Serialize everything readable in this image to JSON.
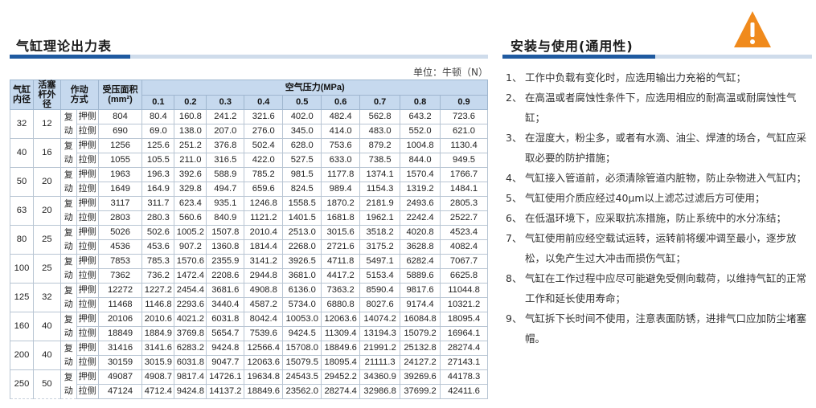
{
  "left": {
    "title": "气缸理论出力表",
    "unit": "单位：牛顿（N）",
    "headers": {
      "bore": "气缸\n内径",
      "rod": "活塞\n杆外径",
      "mode": "作动\n方式",
      "area": "受压面积\n(mm²)",
      "pressure_title": "空气压力(MPa)",
      "pressures": [
        "0.1",
        "0.2",
        "0.3",
        "0.4",
        "0.5",
        "0.6",
        "0.7",
        "0.8",
        "0.9"
      ]
    },
    "mode_label": "复\n动",
    "push_label": "押侧",
    "pull_label": "拉侧",
    "rows": [
      {
        "bore": "32",
        "rod": "12",
        "push": {
          "area": "804",
          "vals": [
            "80.4",
            "160.8",
            "241.2",
            "321.6",
            "402.0",
            "482.4",
            "562.8",
            "643.2",
            "723.6"
          ]
        },
        "pull": {
          "area": "690",
          "vals": [
            "69.0",
            "138.0",
            "207.0",
            "276.0",
            "345.0",
            "414.0",
            "483.0",
            "552.0",
            "621.0"
          ]
        }
      },
      {
        "bore": "40",
        "rod": "16",
        "push": {
          "area": "1256",
          "vals": [
            "125.6",
            "251.2",
            "376.8",
            "502.4",
            "628.0",
            "753.6",
            "879.2",
            "1004.8",
            "1130.4"
          ]
        },
        "pull": {
          "area": "1055",
          "vals": [
            "105.5",
            "211.0",
            "316.5",
            "422.0",
            "527.5",
            "633.0",
            "738.5",
            "844.0",
            "949.5"
          ]
        }
      },
      {
        "bore": "50",
        "rod": "20",
        "push": {
          "area": "1963",
          "vals": [
            "196.3",
            "392.6",
            "588.9",
            "785.2",
            "981.5",
            "1177.8",
            "1374.1",
            "1570.4",
            "1766.7"
          ]
        },
        "pull": {
          "area": "1649",
          "vals": [
            "164.9",
            "329.8",
            "494.7",
            "659.6",
            "824.5",
            "989.4",
            "1154.3",
            "1319.2",
            "1484.1"
          ]
        }
      },
      {
        "bore": "63",
        "rod": "20",
        "push": {
          "area": "3117",
          "vals": [
            "311.7",
            "623.4",
            "935.1",
            "1246.8",
            "1558.5",
            "1870.2",
            "2181.9",
            "2493.6",
            "2805.3"
          ]
        },
        "pull": {
          "area": "2803",
          "vals": [
            "280.3",
            "560.6",
            "840.9",
            "1121.2",
            "1401.5",
            "1681.8",
            "1962.1",
            "2242.4",
            "2522.7"
          ]
        }
      },
      {
        "bore": "80",
        "rod": "25",
        "push": {
          "area": "5026",
          "vals": [
            "502.6",
            "1005.2",
            "1507.8",
            "2010.4",
            "2513.0",
            "3015.6",
            "3518.2",
            "4020.8",
            "4523.4"
          ]
        },
        "pull": {
          "area": "4536",
          "vals": [
            "453.6",
            "907.2",
            "1360.8",
            "1814.4",
            "2268.0",
            "2721.6",
            "3175.2",
            "3628.8",
            "4082.4"
          ]
        }
      },
      {
        "bore": "100",
        "rod": "25",
        "push": {
          "area": "7853",
          "vals": [
            "785.3",
            "1570.6",
            "2355.9",
            "3141.2",
            "3926.5",
            "4711.8",
            "5497.1",
            "6282.4",
            "7067.7"
          ]
        },
        "pull": {
          "area": "7362",
          "vals": [
            "736.2",
            "1472.4",
            "2208.6",
            "2944.8",
            "3681.0",
            "4417.2",
            "5153.4",
            "5889.6",
            "6625.8"
          ]
        }
      },
      {
        "bore": "125",
        "rod": "32",
        "push": {
          "area": "12272",
          "vals": [
            "1227.2",
            "2454.4",
            "3681.6",
            "4908.8",
            "6136.0",
            "7363.2",
            "8590.4",
            "9817.6",
            "11044.8"
          ]
        },
        "pull": {
          "area": "11468",
          "vals": [
            "1146.8",
            "2293.6",
            "3440.4",
            "4587.2",
            "5734.0",
            "6880.8",
            "8027.6",
            "9174.4",
            "10321.2"
          ]
        }
      },
      {
        "bore": "160",
        "rod": "40",
        "push": {
          "area": "20106",
          "vals": [
            "2010.6",
            "4021.2",
            "6031.8",
            "8042.4",
            "10053.0",
            "12063.6",
            "14074.2",
            "16084.8",
            "18095.4"
          ]
        },
        "pull": {
          "area": "18849",
          "vals": [
            "1884.9",
            "3769.8",
            "5654.7",
            "7539.6",
            "9424.5",
            "11309.4",
            "13194.3",
            "15079.2",
            "16964.1"
          ]
        }
      },
      {
        "bore": "200",
        "rod": "40",
        "push": {
          "area": "31416",
          "vals": [
            "3141.6",
            "6283.2",
            "9424.8",
            "12566.4",
            "15708.0",
            "18849.6",
            "21991.2",
            "25132.8",
            "28274.4"
          ]
        },
        "pull": {
          "area": "30159",
          "vals": [
            "3015.9",
            "6031.8",
            "9047.7",
            "12063.6",
            "15079.5",
            "18095.4",
            "21111.3",
            "24127.2",
            "27143.1"
          ]
        }
      },
      {
        "bore": "250",
        "rod": "50",
        "push": {
          "area": "49087",
          "vals": [
            "4908.7",
            "9817.4",
            "14726.1",
            "19634.8",
            "24543.5",
            "29452.2",
            "34360.9",
            "39269.6",
            "44178.3"
          ]
        },
        "pull": {
          "area": "47124",
          "vals": [
            "4712.4",
            "9424.8",
            "14137.2",
            "18849.6",
            "23562.0",
            "28274.4",
            "32986.8",
            "37699.2",
            "42411.6"
          ]
        }
      }
    ]
  },
  "right": {
    "title": "安装与使用(通用性)",
    "warning_icon": "warning-triangle-icon",
    "notes": [
      {
        "num": "1、",
        "text": "工作中负载有变化时，应选用输出力充裕的气缸；"
      },
      {
        "num": "2、",
        "text": "在高温或者腐蚀性条件下，应选用相应的耐高温或耐腐蚀性气缸；"
      },
      {
        "num": "3、",
        "text": "在湿度大，粉尘多，或者有水滴、油尘、焊渣的场合，气缸应采取必要的防护措施；"
      },
      {
        "num": "4、",
        "text": "气缸接入管道前，必须清除管道内脏物，防止杂物进入气缸内；"
      },
      {
        "num": "5、",
        "text": "气缸使用介质应经过40μm以上滤芯过滤后方可使用；"
      },
      {
        "num": "6、",
        "text": "在低温环境下，应采取抗冻措施，防止系统中的水分冻结；"
      },
      {
        "num": "7、",
        "text": "气缸使用前应经空载试运转，运转前将缓冲调至最小，逐步放松，以免产生过大冲击而损伤气缸；"
      },
      {
        "num": "8、",
        "text": "气缸在工作过程中应尽可能避免受侧向载荷，以维持气缸的正常工作和延长使用寿命；"
      },
      {
        "num": "9、",
        "text": "气缸拆下长时间不使用，注意表面防锈，进排气口应加防尘堵塞帽。"
      }
    ]
  },
  "colors": {
    "accent": "#1f5aa0",
    "header_bg": "#c6d9ee",
    "warning": "#f08a1c"
  }
}
